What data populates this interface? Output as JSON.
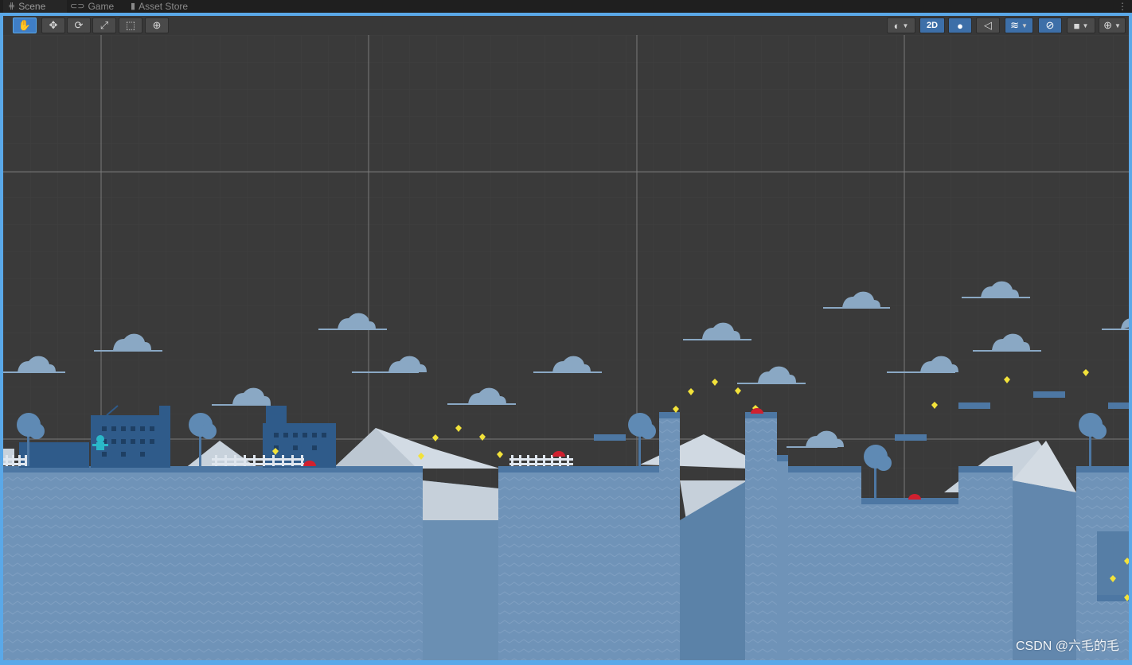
{
  "tabs": [
    {
      "label": "Scene",
      "icon": "grid-icon",
      "active": true
    },
    {
      "label": "Game",
      "icon": "gamepad-icon",
      "active": false
    },
    {
      "label": "Asset Store",
      "icon": "bag-icon",
      "active": false
    }
  ],
  "toolbar": {
    "tools": [
      {
        "name": "hand-tool",
        "icon": "hand-icon",
        "glyph": "✋",
        "selected": true
      },
      {
        "name": "move-tool",
        "icon": "move-icon",
        "glyph": "✥",
        "selected": false
      },
      {
        "name": "rotate-tool",
        "icon": "rotate-icon",
        "glyph": "⟳",
        "selected": false
      },
      {
        "name": "scale-tool",
        "icon": "scale-icon",
        "glyph": "⤢",
        "selected": false
      },
      {
        "name": "rect-tool",
        "icon": "rect-icon",
        "glyph": "⬚",
        "selected": false
      },
      {
        "name": "transform-tool",
        "icon": "transform-icon",
        "glyph": "⊕",
        "selected": false
      }
    ],
    "mode_2d_label": "2D",
    "right_icons": [
      "shading-mode-icon",
      "lighting-icon",
      "audio-mute-icon",
      "effects-icon",
      "hidden-objects-icon",
      "camera-icon",
      "gizmos-icon"
    ]
  },
  "watermark": "CSDN @六毛的毛",
  "colors": {
    "accent": "#5aa8e8",
    "scene_bg": "#3a3a3a",
    "ground": "#6f93b8",
    "ground_top": "#4d77a3",
    "mountain": "#c8d2dc",
    "cloud": "#8aa8c4",
    "gem": "#f2e23a",
    "enemy": "#d0202f",
    "building": "#2f5b8a"
  }
}
